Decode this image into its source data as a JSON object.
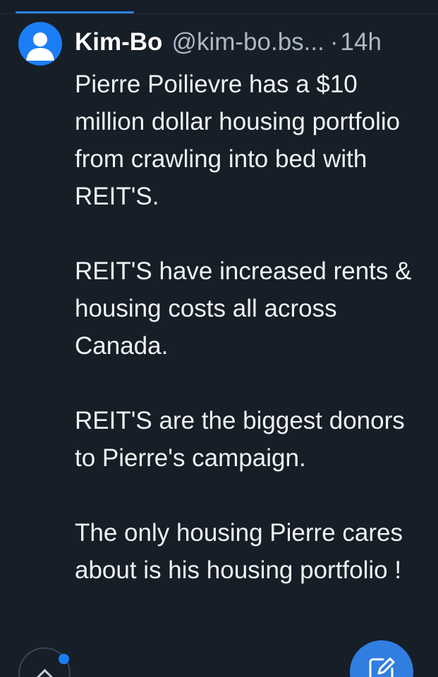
{
  "post": {
    "author_name": "Kim-Bo",
    "author_handle": "@kim-bo.bs...",
    "separator": "·",
    "time_ago": "14h",
    "paragraphs": [
      "Pierre Poilievre has a $10 million dollar housing portfolio from crawling into bed with REIT'S.",
      "REIT'S have increased rents & housing costs all across Canada.",
      "REIT'S are the biggest donors to Pierre's campaign.",
      "The only housing Pierre cares about is his housing portfolio !"
    ]
  },
  "icons": {
    "avatar": "default-user-avatar-icon",
    "reply": "chevron-up-icon",
    "compose": "compose-pencil-icon"
  },
  "colors": {
    "background": "#161e27",
    "accent": "#2f7ee0",
    "avatar": "#1c7ef6",
    "text": "#f1f3f5",
    "muted": "#aeb8c4"
  }
}
